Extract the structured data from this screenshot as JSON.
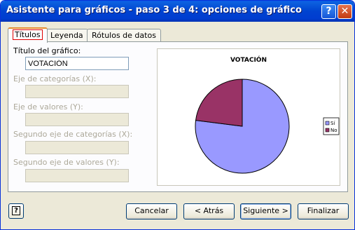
{
  "window": {
    "title": "Asistente para gráficos - paso 3 de 4: opciones de gráfico",
    "help_glyph": "?",
    "close_glyph": "✕"
  },
  "tabs": [
    {
      "label": "Títulos",
      "active": true
    },
    {
      "label": "Leyenda",
      "active": false
    },
    {
      "label": "Rótulos de datos",
      "active": false
    }
  ],
  "fields": {
    "chart_title": {
      "label": "Título del gráfico:",
      "value": "VOTACIÓN",
      "enabled": true
    },
    "category_x": {
      "label": "Eje de categorías (X):",
      "value": "",
      "enabled": false
    },
    "value_y": {
      "label": "Eje de valores (Y):",
      "value": "",
      "enabled": false
    },
    "second_category_x": {
      "label": "Segundo eje de categorías (X):",
      "value": "",
      "enabled": false
    },
    "second_value_y": {
      "label": "Segundo eje de valores (Y):",
      "value": "",
      "enabled": false
    }
  },
  "chart_data": {
    "type": "pie",
    "title": "VOTACIÓN",
    "categories": [
      "Sí",
      "No"
    ],
    "values": [
      77,
      23
    ],
    "colors": [
      "#9999ff",
      "#993366"
    ],
    "legend_position": "right"
  },
  "buttons": {
    "help_glyph": "?",
    "cancel": "Cancelar",
    "back": "< Atrás",
    "next": "Siguiente >",
    "finish": "Finalizar"
  }
}
